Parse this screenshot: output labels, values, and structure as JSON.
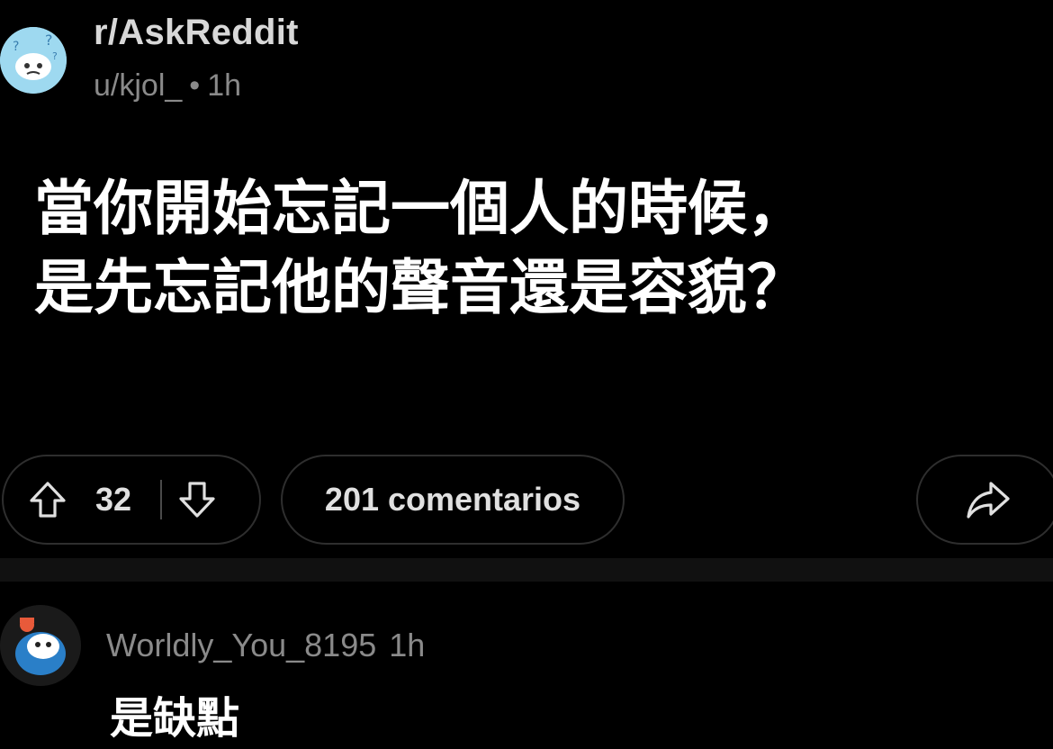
{
  "post": {
    "subreddit": "r/AskReddit",
    "author": "u/kjol_",
    "separator": "•",
    "age": "1h",
    "title_lines": [
      "當你開始忘記一個人的時候，",
      "是先忘記他的聲音還是容貌？"
    ],
    "vote_count": "32",
    "comments_label": "201 comentarios"
  },
  "comment": {
    "username": "Worldly_You_8195",
    "age": "1h",
    "text": "是缺點"
  },
  "icons": {
    "subreddit_avatar": "reddit-snoo-confused-icon",
    "upvote": "arrow-up-outline-icon",
    "downvote": "arrow-down-outline-icon",
    "share": "share-arrow-icon",
    "commenter_avatar": "reddit-snoo-avatar-icon"
  },
  "colors": {
    "background": "#000000",
    "title_text": "#ffffff",
    "meta_text": "#8a8a8a",
    "pill_border": "#2e2e2e",
    "subreddit_avatar_bg": "#9ed9f0"
  }
}
